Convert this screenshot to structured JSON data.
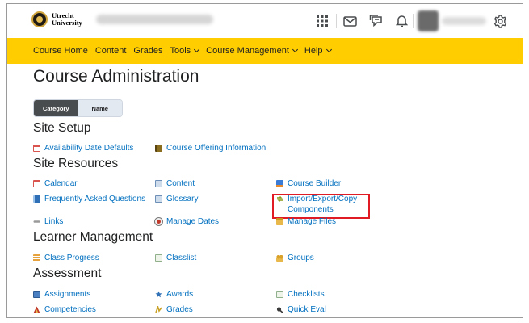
{
  "header": {
    "logo": {
      "line1": "Utrecht",
      "line2": "University"
    },
    "icons": [
      "waffle-icon",
      "mail-icon",
      "chat-icon",
      "bell-icon",
      "gear-icon"
    ]
  },
  "nav": {
    "items": [
      {
        "label": "Course Home",
        "dropdown": false
      },
      {
        "label": "Content",
        "dropdown": false
      },
      {
        "label": "Grades",
        "dropdown": false
      },
      {
        "label": "Tools",
        "dropdown": true
      },
      {
        "label": "Course Management",
        "dropdown": true
      },
      {
        "label": "Help",
        "dropdown": true
      }
    ],
    "background": "#ffcd00"
  },
  "page": {
    "title": "Course Administration",
    "toggle": {
      "category": "Category",
      "name": "Name",
      "selected": "Category"
    }
  },
  "sections": {
    "site_setup": {
      "title": "Site Setup",
      "tools": [
        {
          "label": "Availability Date Defaults",
          "icon": "calendar-icon"
        },
        {
          "label": "Course Offering Information",
          "icon": "book-icon"
        }
      ]
    },
    "site_resources": {
      "title": "Site Resources",
      "tools": [
        {
          "label": "Calendar",
          "icon": "calendar-icon"
        },
        {
          "label": "Content",
          "icon": "open-book-icon"
        },
        {
          "label": "Course Builder",
          "icon": "blocks-icon"
        },
        {
          "label": "Frequently Asked Questions",
          "icon": "faq-icon"
        },
        {
          "label": "Glossary",
          "icon": "open-book-icon"
        },
        {
          "label": "Import/Export/Copy Components",
          "icon": "import-export-icon"
        },
        {
          "label": "Links",
          "icon": "link-icon"
        },
        {
          "label": "Manage Dates",
          "icon": "manage-dates-icon"
        },
        {
          "label": "Manage Files",
          "icon": "folder-icon"
        }
      ]
    },
    "learner_management": {
      "title": "Learner Management",
      "tools": [
        {
          "label": "Class Progress",
          "icon": "progress-icon"
        },
        {
          "label": "Classlist",
          "icon": "classlist-icon"
        },
        {
          "label": "Groups",
          "icon": "groups-icon"
        }
      ]
    },
    "assessment": {
      "title": "Assessment",
      "tools": [
        {
          "label": "Assignments",
          "icon": "assignment-icon"
        },
        {
          "label": "Awards",
          "icon": "award-icon"
        },
        {
          "label": "Checklists",
          "icon": "checklist-icon"
        },
        {
          "label": "Competencies",
          "icon": "competency-icon"
        },
        {
          "label": "Grades",
          "icon": "grades-icon"
        },
        {
          "label": "Quick Eval",
          "icon": "quick-eval-icon"
        }
      ]
    }
  },
  "colors": {
    "link": "#006fbf",
    "highlight": "#e01b24",
    "toggle_active": "#494c4e"
  }
}
